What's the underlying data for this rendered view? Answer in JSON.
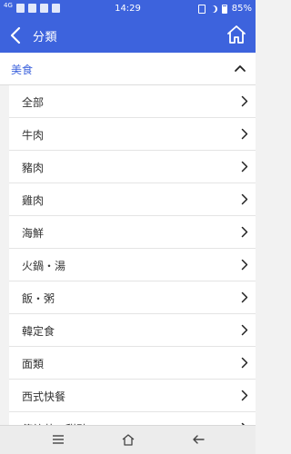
{
  "status_bar": {
    "time": "14:29",
    "battery": "85%",
    "signal_label": "4G",
    "left_icons": [
      "signal-icon",
      "sync-icon",
      "wifi-off-icon",
      "gallery-icon",
      "facebook-icon"
    ],
    "right_icons": [
      "vibrate-icon",
      "moon-icon",
      "battery-icon"
    ]
  },
  "header": {
    "title": "分類",
    "back_icon": "back-chevron-icon",
    "home_icon": "home-icon"
  },
  "section": {
    "title": "美食",
    "toggle_icon": "chevron-up-icon"
  },
  "items": [
    {
      "label": "全部"
    },
    {
      "label": "牛肉"
    },
    {
      "label": "豬肉"
    },
    {
      "label": "雞肉"
    },
    {
      "label": "海鮮"
    },
    {
      "label": "火鍋・湯"
    },
    {
      "label": "飯・粥"
    },
    {
      "label": "韓定食"
    },
    {
      "label": "面類"
    },
    {
      "label": "西式快餐"
    },
    {
      "label": "傳統茶・甜點"
    }
  ],
  "nav": {
    "icons": [
      "menu-icon",
      "home-icon",
      "back-arrow-icon"
    ]
  },
  "colors": {
    "primary": "#3d63dd",
    "divider": "#e4e4e4",
    "text": "#333333",
    "background": "#f2f2f2"
  }
}
